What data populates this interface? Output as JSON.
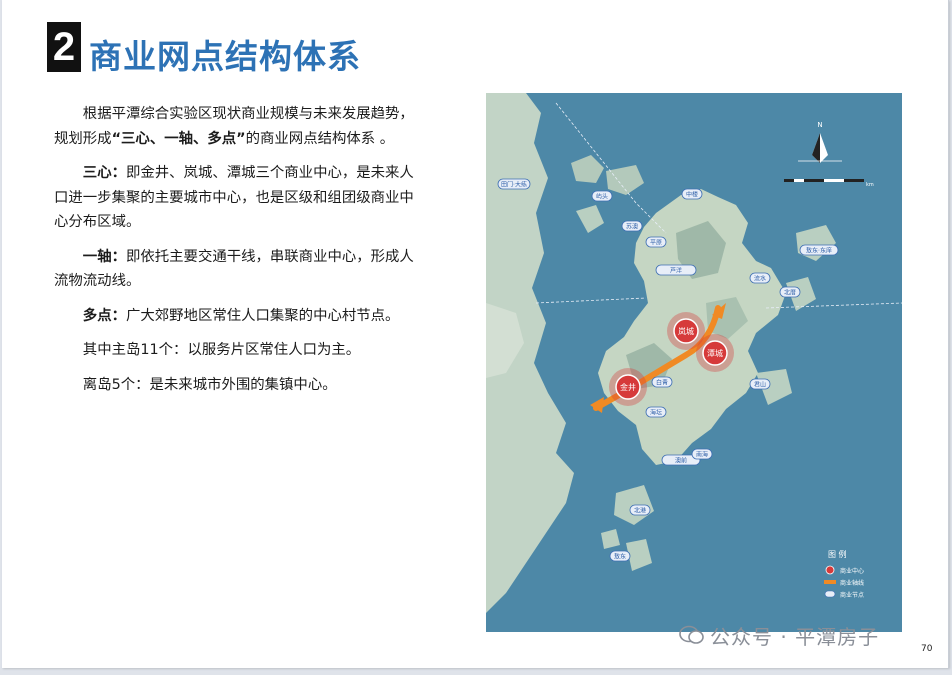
{
  "header": {
    "number": "2",
    "title": "商业网点结构体系"
  },
  "body": {
    "p1_a": "根据平潭综合实验区现状商业规模与未来发展趋势，规划形成",
    "p1_b": "“三心、一轴、多点”",
    "p1_c": "的商业网点结构体系 。",
    "p2_term": "三心：",
    "p2_text": "即金井、岚城、潭城三个商业中心，是未来人口进一步集聚的主要城市中心，也是区级和组团级商业中心分布区域。",
    "p3_term": "一轴：",
    "p3_text": "即依托主要交通干线，串联商业中心，形成人流物流动线。",
    "p4_term": "多点：",
    "p4_text": "广大郊野地区常住人口集聚的中心村节点。",
    "p5": "其中主岛11个：以服务片区常住人口为主。",
    "p6": "离岛5个：是未来城市外围的集镇中心。"
  },
  "map": {
    "centers": [
      "岚城",
      "潭城",
      "金井"
    ],
    "nodes": [
      "田门·大练",
      "屿头",
      "苏澳",
      "平原",
      "中楼",
      "芦洋",
      "流水",
      "敖东·东庠",
      "北厝",
      "白青",
      "君山",
      "海坛",
      "澳前",
      "北港",
      "敖东",
      "南海"
    ],
    "north": "N",
    "scale_label": "km",
    "legend": {
      "title": "图 例",
      "items": [
        "商业中心",
        "商业轴线",
        "商业节点"
      ]
    },
    "colors": {
      "sea": "#4d88a7",
      "land": "#b9cfc1",
      "center": "#d63a3a",
      "axis": "#f08a24",
      "node": "#3d6eb3"
    }
  },
  "page_number": "70",
  "watermark": "公众号 · 平潭房子"
}
